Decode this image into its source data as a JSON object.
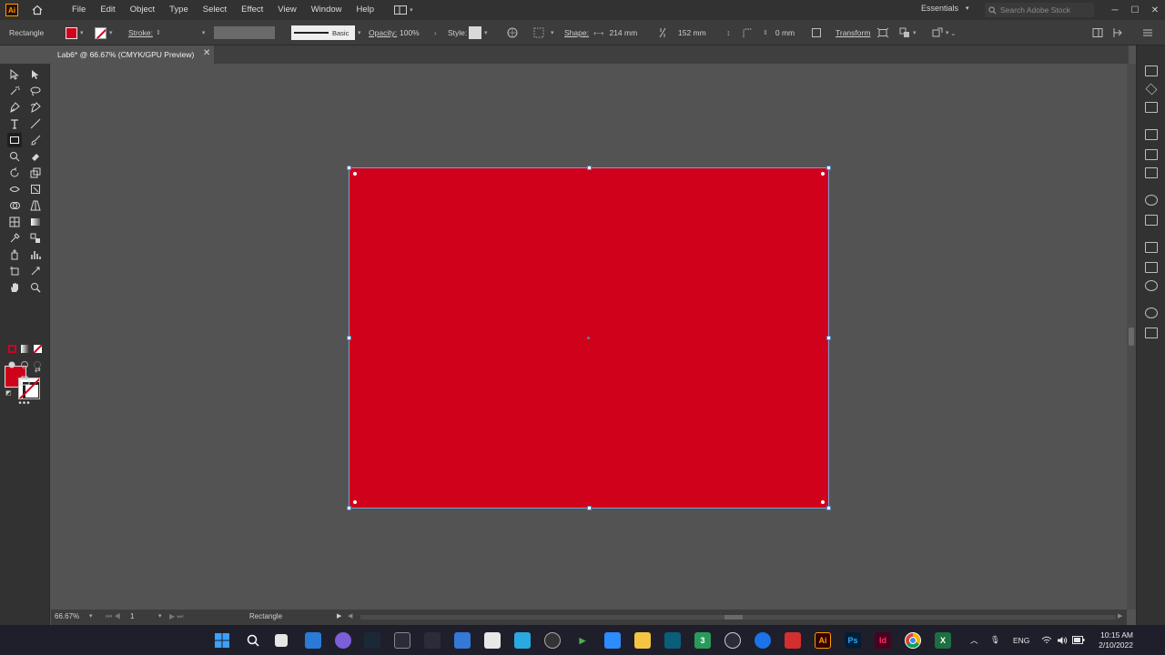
{
  "app": {
    "logo_text": "Ai",
    "menu": [
      "File",
      "Edit",
      "Object",
      "Type",
      "Select",
      "Effect",
      "View",
      "Window",
      "Help"
    ],
    "workspace": "Essentials",
    "stock_search_placeholder": "Search Adobe Stock"
  },
  "control_bar": {
    "selection_label": "Rectangle",
    "stroke_label": "Stroke:",
    "stroke_profile": "Basic",
    "opacity_label": "Opacity:",
    "opacity_value": "100%",
    "style_label": "Style:",
    "shape_label": "Shape:",
    "width_value": "214 mm",
    "height_value": "152 mm",
    "corner_value": "0 mm",
    "transform_label": "Transform"
  },
  "document": {
    "tab_title": "Lab6* @ 66.67% (CMYK/GPU Preview)",
    "close_symbol": "✕"
  },
  "colors": {
    "fill": "#d0011b",
    "selection": "#5b7fb8"
  },
  "status_bar": {
    "zoom": "66.67%",
    "artboard_number": "1",
    "status_text": "Rectangle"
  },
  "taskbar": {
    "language": "ENG",
    "time": "10:15 AM",
    "date": "2/10/2022"
  }
}
